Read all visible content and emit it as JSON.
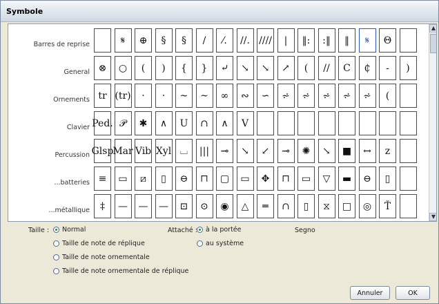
{
  "window": {
    "title": "Symbole"
  },
  "rows": [
    {
      "label": "Barres de reprise",
      "cells": [
        "",
        "𝄋",
        "⊕",
        "§",
        "§",
        "/",
        "⁄.",
        "//.",
        "////",
        "|",
        "‖:",
        ":‖",
        "‖",
        "𝄋",
        "Θ",
        ""
      ]
    },
    {
      "label": "General",
      "cells": [
        "⊗",
        "○",
        "(",
        ")",
        "{",
        "}",
        "⤶",
        "↘",
        "↘",
        "↗",
        "(",
        "//",
        "C",
        "₵",
        "-",
        ")"
      ]
    },
    {
      "label": "Ornements",
      "cells": [
        "tr",
        "(tr)",
        "·",
        "·",
        "~",
        "~",
        "∞",
        "∾",
        "∽",
        "⩫",
        "⩫",
        "⩫",
        "⩫",
        "⩫",
        "(",
        ""
      ]
    },
    {
      "label": "Clavier",
      "cells": [
        "Ped.",
        "𝒫",
        "✱",
        "∧",
        "U",
        "∩",
        "∧",
        "V",
        "",
        "",
        "",
        "",
        "",
        "",
        "",
        ""
      ]
    },
    {
      "label": "Percussion",
      "cells": [
        "Glsp",
        "Mar",
        "Vib",
        "Xyl",
        "⌴",
        "|||",
        "⊸",
        "↘",
        "↙",
        "⊸",
        "✺",
        "↘",
        "■",
        "↔",
        "z",
        ""
      ]
    },
    {
      "label": "...batteries",
      "cells": [
        "≡",
        "▭",
        "⧄",
        "▯",
        "⊖",
        "⊓",
        "▢",
        "▭",
        "✥",
        "⊓",
        "▭",
        "▽",
        "▬",
        "⊖",
        "▯",
        ""
      ]
    },
    {
      "label": "...métallique",
      "cells": [
        "‡",
        "—",
        "—",
        "—",
        "⊡",
        "⊙",
        "◉",
        "△",
        "═",
        "∩",
        "▯",
        "⧖",
        "□",
        "◎",
        "Ť",
        ""
      ]
    }
  ],
  "options": {
    "taille_label": "Taille :",
    "taille": [
      "Normal",
      "Taille de note de réplique",
      "Taille de note ornementale",
      "Taille de note ornementale de réplique"
    ],
    "attache_label": "Attaché :",
    "attache": [
      "à la portée",
      "au système"
    ],
    "symbol_name": "Segno"
  },
  "buttons": {
    "cancel": "Annuler",
    "ok": "OK"
  },
  "scrollbar": {
    "up": "▲",
    "down": "▼"
  }
}
